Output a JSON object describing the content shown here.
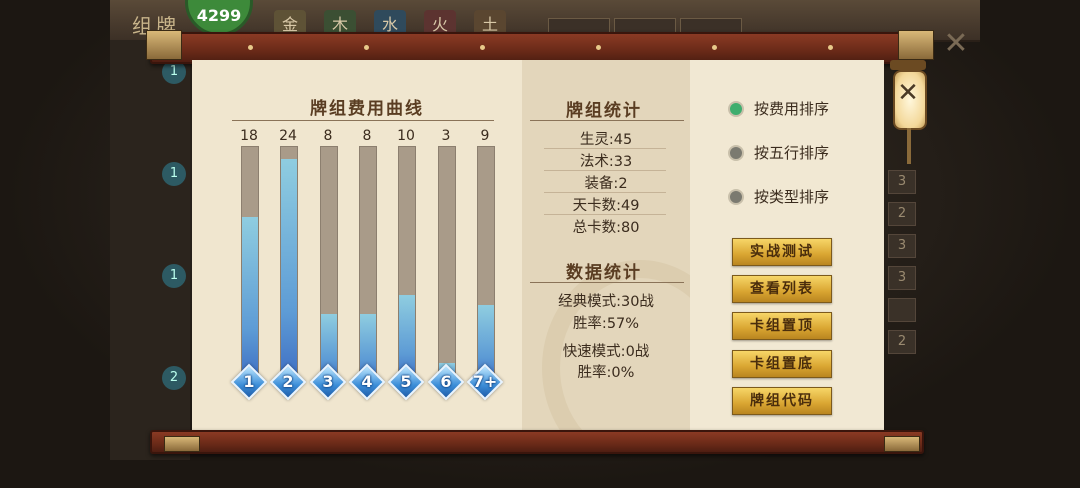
{
  "background": {
    "title": "组牌",
    "element_tabs": [
      "金",
      "木",
      "水",
      "火",
      "土"
    ],
    "element_colors": [
      "#c8a84a",
      "#4a8a4a",
      "#3a7ab8",
      "#b8443a",
      "#a0703a"
    ],
    "coin_value": "4299",
    "right_numbers": [
      "3",
      "2",
      "3",
      "3",
      "",
      "2"
    ],
    "left_circles": [
      "1",
      "1",
      "1",
      "2"
    ],
    "filters": [
      "",
      "",
      ""
    ]
  },
  "curve": {
    "title": "牌组费用曲线",
    "counts": [
      "18",
      "24",
      "8",
      "8",
      "10",
      "3",
      "9"
    ],
    "labels": [
      "1",
      "2",
      "3",
      "4",
      "5",
      "6",
      "7+"
    ],
    "fill_fractions": [
      0.7,
      0.95,
      0.28,
      0.28,
      0.36,
      0.07,
      0.32
    ]
  },
  "deck_stats": {
    "title": "牌组统计",
    "lines": [
      "生灵:45",
      "法术:33",
      "装备:2",
      "天卡数:49",
      "总卡数:80"
    ]
  },
  "data_stats": {
    "title": "数据统计",
    "classic_mode": "经典模式:30战",
    "classic_rate": "胜率:57%",
    "quick_mode": "快速模式:0战",
    "quick_rate": "胜率:0%"
  },
  "sort_options": [
    {
      "label": "按费用排序",
      "selected": true
    },
    {
      "label": "按五行排序",
      "selected": false
    },
    {
      "label": "按类型排序",
      "selected": false
    }
  ],
  "buttons": [
    "实战测试",
    "查看列表",
    "卡组置顶",
    "卡组置底",
    "牌组代码"
  ],
  "close_label": "✕"
}
